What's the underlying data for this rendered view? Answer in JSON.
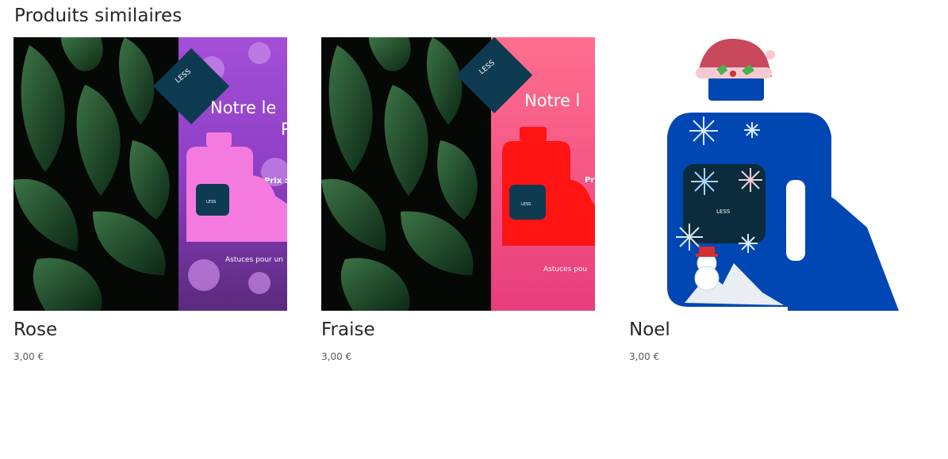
{
  "section": {
    "title": "Produits similaires"
  },
  "products": [
    {
      "name": "Rose",
      "price": "3,00 €",
      "image": {
        "brand": "LESS",
        "headline_1": "Notre  le",
        "headline_2": "P",
        "price_hint": "Prix :",
        "tagline": "Astuces pour un",
        "accent_color": "#f57ae0",
        "panel_color": "#9b47c9"
      }
    },
    {
      "name": "Fraise",
      "price": "3,00 €",
      "image": {
        "brand": "LESS",
        "headline_1": "Notre  l",
        "price_hint": "Pri",
        "tagline": "Astuces pou",
        "accent_color": "#ff1414",
        "panel_color": "#f45a86"
      }
    },
    {
      "name": "Noel",
      "price": "3,00 €",
      "image": {
        "brand": "LESS",
        "bottle_color": "#0047b3"
      }
    }
  ]
}
